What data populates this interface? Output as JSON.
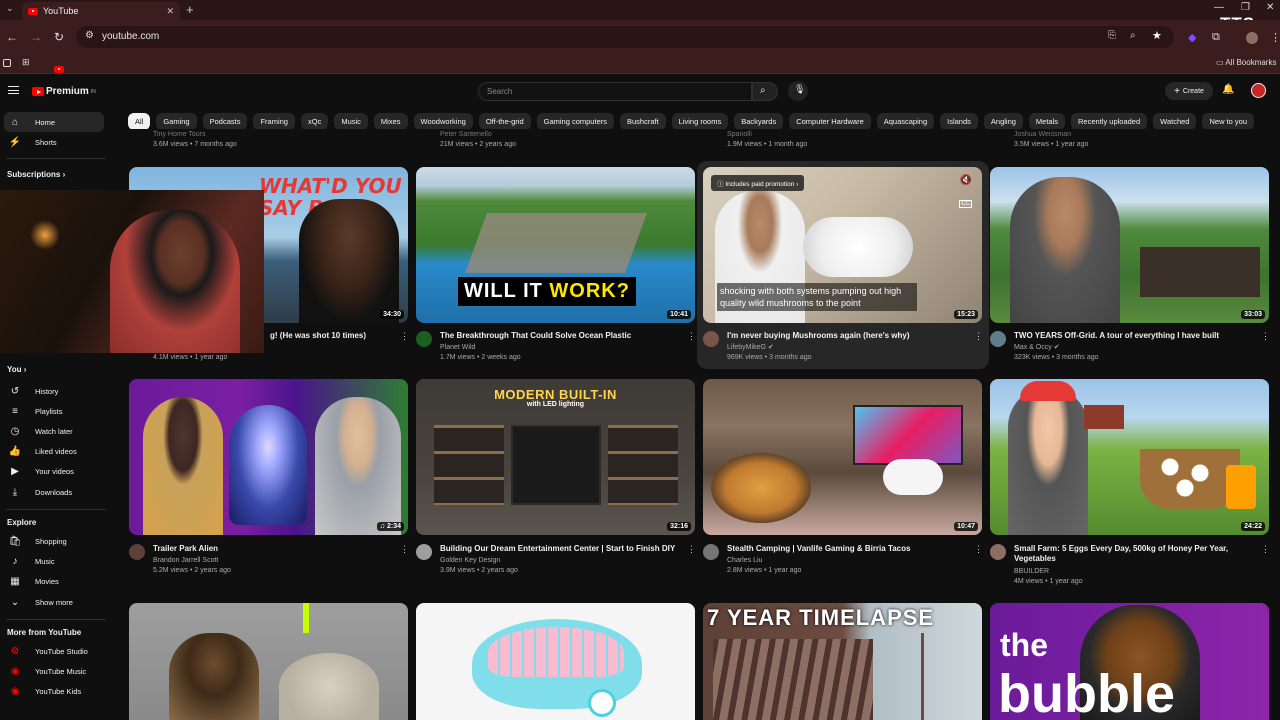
{
  "browser": {
    "tab_title": "YouTube",
    "url": "youtube.com",
    "bookmarks_label": "All Bookmarks",
    "watermark": "TTS"
  },
  "header": {
    "logo_text": "Premium",
    "logo_sup": "IN",
    "search_placeholder": "Search",
    "create_label": "Create"
  },
  "chips": [
    "All",
    "Gaming",
    "Podcasts",
    "Framing",
    "xQc",
    "Music",
    "Mixes",
    "Woodworking",
    "Off-the-grid",
    "Gaming computers",
    "Bushcraft",
    "Living rooms",
    "Backyards",
    "Computer Hardware",
    "Aquascaping",
    "Islands",
    "Angling",
    "Metals",
    "Recently uploaded",
    "Watched",
    "New to you"
  ],
  "sidebar": {
    "home": "Home",
    "shorts": "Shorts",
    "subscriptions": "Subscriptions",
    "you": "You",
    "history": "History",
    "playlists": "Playlists",
    "watch_later": "Watch later",
    "liked": "Liked videos",
    "your_videos": "Your videos",
    "downloads": "Downloads",
    "explore": "Explore",
    "shopping": "Shopping",
    "music": "Music",
    "movies": "Movies",
    "show_more": "Show more",
    "more_from": "More from YouTube",
    "studio": "YouTube Studio",
    "yt_music": "YouTube Music",
    "kids": "YouTube Kids"
  },
  "row0": [
    {
      "channel": "Tiny Home Tours",
      "meta": "3.6M views • 7 months ago"
    },
    {
      "channel": "Peter Santenello",
      "meta": "21M views • 2 years ago"
    },
    {
      "channel": "Spanolli",
      "meta": "1.9M views • 1 month ago"
    },
    {
      "channel": "Joshua Weissman",
      "meta": "3.5M views • 1 year ago"
    }
  ],
  "row1": [
    {
      "title": "g! (He was shot 10 times)",
      "channel": "",
      "meta": "4.1M views • 1 year ago",
      "duration": "34:30",
      "thumb_text": "WHAT'D YOU SAY BOY"
    },
    {
      "title": "The Breakthrough That Could Solve Ocean Plastic",
      "channel": "Planet Wild",
      "meta": "1.7M views • 2 weeks ago",
      "duration": "10:41",
      "thumb_text_a": "WILL IT ",
      "thumb_text_b": "WORK?"
    },
    {
      "title": "I'm never buying Mushrooms again (here's why)",
      "channel": "LifebyMikeG",
      "meta": "969K views • 3 months ago",
      "duration": "15:23",
      "promo": "Includes paid promotion",
      "caption": "shocking with both systems pumping out high quality wild mushrooms to the point"
    },
    {
      "title": "TWO YEARS Off-Grid. A tour of everything I have built",
      "channel": "Max & Occy",
      "meta": "323K views • 3 months ago",
      "duration": "33:03"
    }
  ],
  "row2": [
    {
      "title": "Trailer Park Alien",
      "channel": "Brandon Jarrell Scott",
      "meta": "5.2M views • 2 years ago",
      "duration": "2:34"
    },
    {
      "title": "Building Our Dream Entertainment Center | Start to Finish DIY",
      "channel": "Golden Key Design",
      "meta": "3.9M views • 2 years ago",
      "duration": "32:16",
      "thumb_text": "MODERN BUILT-IN",
      "thumb_sub": "with LED lighting"
    },
    {
      "title": "Stealth Camping | Vanlife Gaming & Birria Tacos",
      "channel": "Charles Liu",
      "meta": "2.8M views • 1 year ago",
      "duration": "10:47"
    },
    {
      "title": "Small Farm: 5 Eggs Every Day, 500kg of Honey Per Year, Vegetables",
      "channel": "BBUILDER",
      "meta": "4M views • 1 year ago",
      "duration": "24:22"
    }
  ],
  "row3": [
    {
      "thumb_text": ""
    },
    {
      "thumb_text": ""
    },
    {
      "thumb_text": "7 YEAR TIMELAPSE"
    },
    {
      "thumb_text_a": "the",
      "thumb_text_b": "bubble"
    }
  ]
}
